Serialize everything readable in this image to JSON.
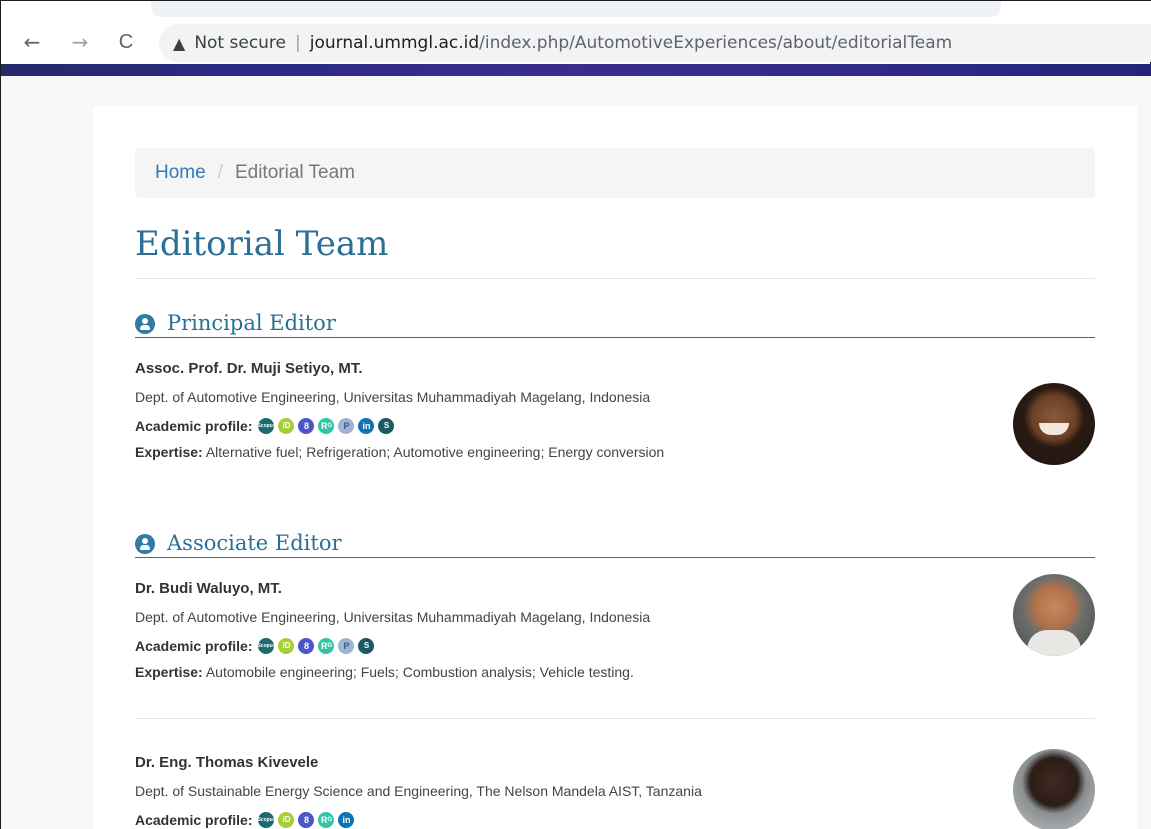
{
  "browser": {
    "back_icon": "←",
    "forward_icon": "→",
    "reload_icon": "C",
    "warning_icon": "▲",
    "security_label": "Not secure",
    "separator": "|",
    "url_host": "journal.ummgl.ac.id",
    "url_path": "/index.php/AutomotiveExperiences/about/editorialTeam"
  },
  "breadcrumb": {
    "home": "Home",
    "separator": "/",
    "current": "Editorial Team"
  },
  "page_title": "Editorial Team",
  "profile_icons": {
    "scopus": "Scopus",
    "orcid": "iD",
    "scholar": "8",
    "researchgate": "Rᴳ",
    "publons": "P",
    "linkedin": "in",
    "sinta": "S"
  },
  "sections": [
    {
      "title": "Principal Editor",
      "members": [
        {
          "name": "Assoc. Prof. Dr. Muji Setiyo, MT.",
          "dept": "Dept. of Automotive Engineering, Universitas Muhammadiyah Magelang, Indonesia",
          "profile_label": "Academic profile:",
          "profiles": [
            "scopus",
            "orcid",
            "scholar",
            "researchgate",
            "publons",
            "linkedin",
            "sinta"
          ],
          "expertise_label": "Expertise:",
          "expertise": " Alternative fuel; Refrigeration; Automotive engineering; Energy conversion"
        }
      ]
    },
    {
      "title": "Associate Editor",
      "members": [
        {
          "name": "Dr. Budi Waluyo, MT.",
          "dept": "Dept. of Automotive Engineering, Universitas Muhammadiyah Magelang, Indonesia",
          "profile_label": "Academic profile:",
          "profiles": [
            "scopus",
            "orcid",
            "scholar",
            "researchgate",
            "publons",
            "sinta"
          ],
          "expertise_label": "Expertise:",
          "expertise": " Automobile engineering; Fuels; Combustion analysis; Vehicle testing."
        },
        {
          "name": "Dr. Eng. Thomas Kivevele",
          "dept": "Dept. of Sustainable Energy Science and Engineering, The Nelson Mandela AIST, Tanzania",
          "profile_label": "Academic profile:",
          "profiles": [
            "scopus",
            "orcid",
            "scholar",
            "researchgate",
            "linkedin"
          ]
        }
      ]
    }
  ]
}
